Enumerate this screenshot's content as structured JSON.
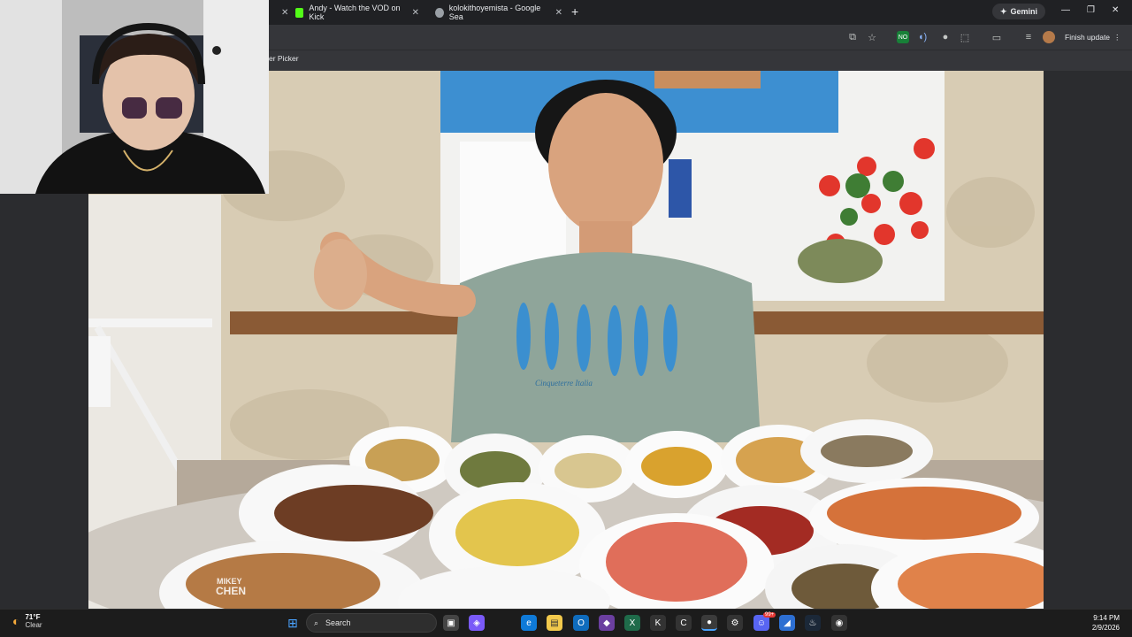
{
  "browser": {
    "tabs": [
      {
        "label": "Andy - Watch the VOD on Kick",
        "favicon_color": "#53fc18"
      },
      {
        "label": "kolokithoyemista - Google Sea",
        "favicon_color": "#9aa0a6"
      }
    ],
    "gemini_label": "Gemini",
    "finish_update_label": "Finish update",
    "bookmark_label": "er Picker"
  },
  "video": {
    "watermark_line1": "MIKEY",
    "watermark_line2": "CHEN",
    "shirt_text": "Cinqueterre Italia"
  },
  "taskbar": {
    "weather_temp": "71°F",
    "weather_condition": "Clear",
    "search_label": "Search",
    "time": "9:14 PM",
    "date": "2/9/2026",
    "badge_count": "99+"
  },
  "colors": {
    "chrome_dark": "#202124",
    "chrome_toolbar": "#35363a",
    "taskbar": "#1c1c1c",
    "kick_green": "#53fc18"
  }
}
